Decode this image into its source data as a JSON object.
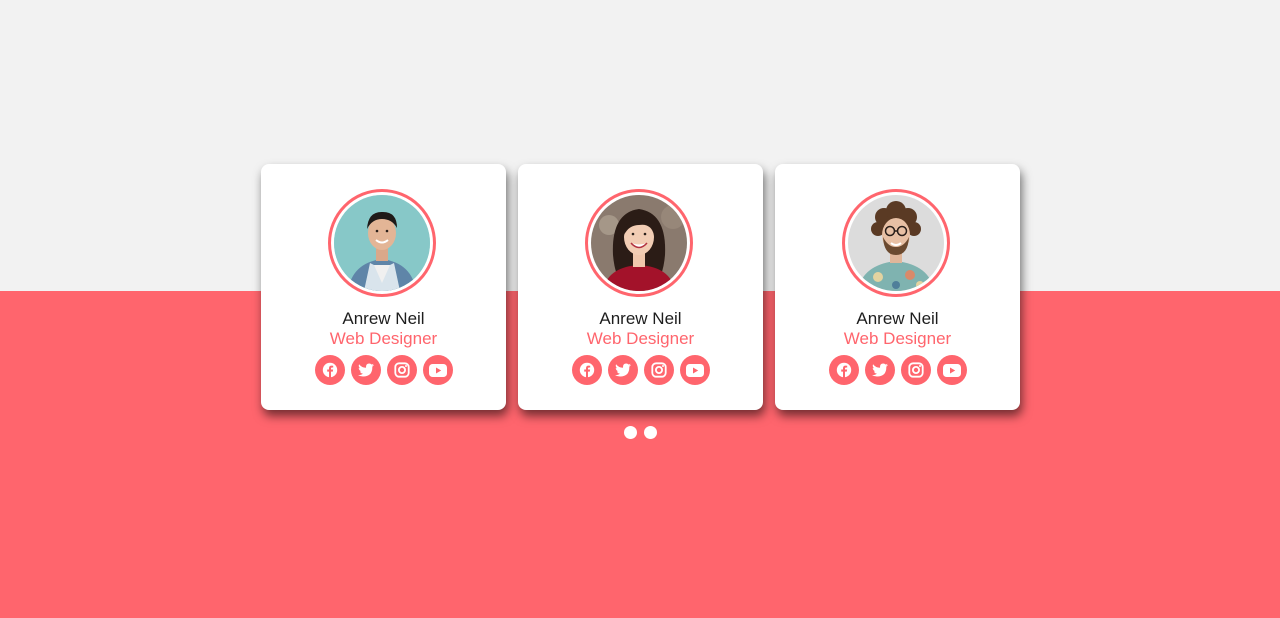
{
  "colors": {
    "accent": "#ff656d",
    "background_top": "#f2f2f2",
    "card": "#ffffff",
    "name_text": "#1e1e1e"
  },
  "cards": [
    {
      "name": "Anrew Neil",
      "role": "Web Designer",
      "avatar": "young man with teal background",
      "socials": [
        "facebook-icon",
        "twitter-icon",
        "instagram-icon",
        "youtube-icon"
      ]
    },
    {
      "name": "Anrew Neil",
      "role": "Web Designer",
      "avatar": "smiling woman in red top",
      "socials": [
        "facebook-icon",
        "twitter-icon",
        "instagram-icon",
        "youtube-icon"
      ]
    },
    {
      "name": "Anrew Neil",
      "role": "Web Designer",
      "avatar": "curly-haired man with glasses",
      "socials": [
        "facebook-icon",
        "twitter-icon",
        "instagram-icon",
        "youtube-icon"
      ]
    }
  ],
  "pagination": {
    "count": 2,
    "active": 1
  }
}
